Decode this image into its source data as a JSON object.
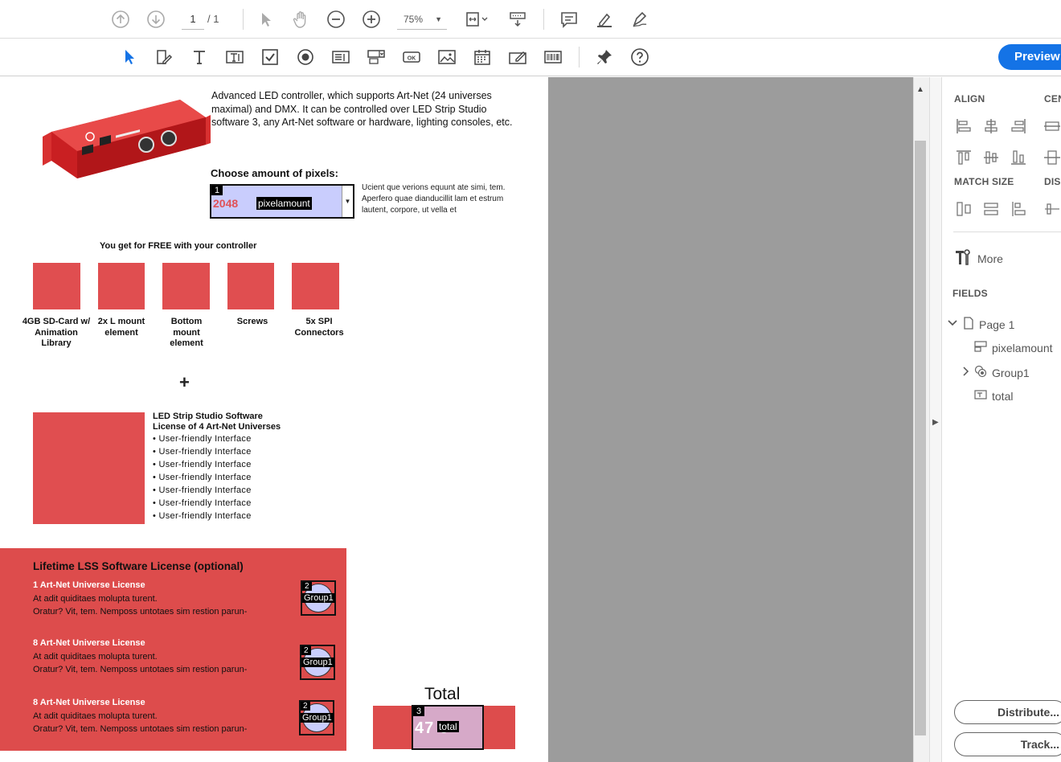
{
  "toolbar1": {
    "page_current": "1",
    "page_total": "/ 1",
    "zoom": "75%"
  },
  "toolbar2": {
    "preview_label": "Preview"
  },
  "document": {
    "description": "Advanced LED controller, which supports Art-Net (24 universes maximal) and DMX. It can be controlled over LED Strip Studio software 3, any Art-Net software or hardware, lighting consoles, etc.",
    "choose_label": "Choose amount of pixels:",
    "pixel_field": {
      "tab_order": "1",
      "value": "2048",
      "name": "pixelamount"
    },
    "side_text": "Ucient que verions equunt ate simi, tem. Aperfero quae dianducillit lam et estrum lautent, corpore, ut vella et",
    "free_heading": "You get for FREE with your controller",
    "free_items": [
      {
        "label": "4GB SD-Card w/ Animation Library"
      },
      {
        "label": "2x L mount element"
      },
      {
        "label": "Bottom mount element"
      },
      {
        "label": "Screws"
      },
      {
        "label": "5x SPI Connectors"
      }
    ],
    "plus": "+",
    "lss_title1": "LED Strip Studio Software",
    "lss_title2": "License of  4 Art-Net Universes",
    "lss_bullets": [
      "• User-friendly Interface",
      "• User-friendly Interface",
      "• User-friendly Interface",
      "• User-friendly Interface",
      "• User-friendly Interface",
      "• User-friendly Interface",
      "• User-friendly Interface"
    ],
    "lifetime_title": "Lifetime LSS Software License (optional)",
    "licenses": [
      {
        "title": "1 Art-Net Universe License",
        "line1": "At adit quiditaes molupta turent.",
        "line2": "Oratur? Vit, tem. Nemposs untotaes sim restion parun-",
        "badge": "2",
        "group": "Group1"
      },
      {
        "title": "8 Art-Net Universe License",
        "line1": "At adit quiditaes molupta turent.",
        "line2": "Oratur? Vit, tem. Nemposs untotaes sim restion parun-",
        "badge": "2",
        "group": "Group1"
      },
      {
        "title": "8 Art-Net Universe License",
        "line1": "At adit quiditaes molupta turent.",
        "line2": "Oratur? Vit, tem. Nemposs untotaes sim restion parun-",
        "badge": "2",
        "group": "Group1"
      }
    ],
    "total_label": "Total",
    "total_field": {
      "tab_order": "3",
      "value": "47  0",
      "name": "total"
    }
  },
  "right_panel": {
    "align_title": "ALIGN",
    "center_title": "CEN",
    "match_size_title": "MATCH SIZE",
    "distribute_title": "DIS",
    "more_label": "More",
    "fields_title": "FIELDS",
    "tree": {
      "page": "Page 1",
      "items": [
        "pixelamount",
        "Group1",
        "total"
      ]
    },
    "distribute_button": "Distribute...",
    "track_button": "Track..."
  }
}
